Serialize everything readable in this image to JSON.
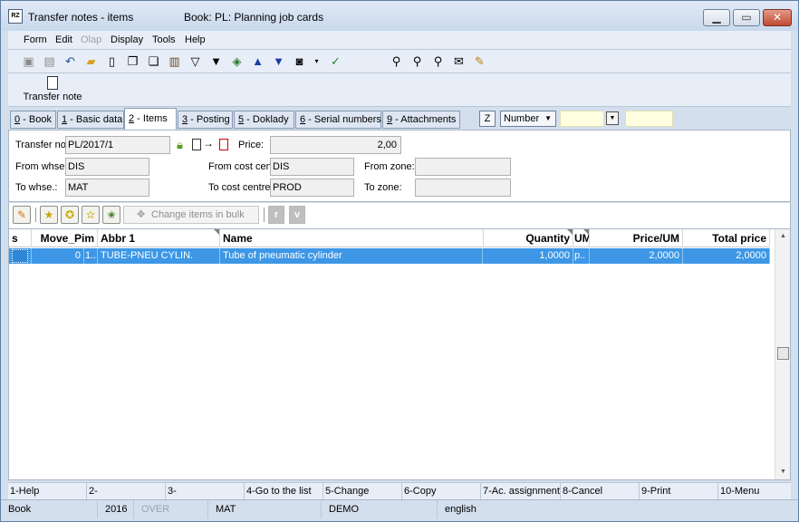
{
  "window": {
    "title": "Transfer notes - items",
    "book_title": "Book: PL: Planning job cards",
    "app_icon_text": "RZ"
  },
  "menu": {
    "items": [
      "Form",
      "Edit",
      "Olap",
      "Display",
      "Tools",
      "Help"
    ]
  },
  "quickbar": {
    "transfer_note_label": "Transfer note"
  },
  "tabs": [
    {
      "key": "0",
      "label": " - Book"
    },
    {
      "key": "1",
      "label": " - Basic data"
    },
    {
      "key": "2",
      "label": " - Items"
    },
    {
      "key": "3",
      "label": " - Posting"
    },
    {
      "key": "5",
      "label": " - Doklady"
    },
    {
      "key": "6",
      "label": " - Serial numbers"
    },
    {
      "key": "9",
      "label": " - Attachments"
    }
  ],
  "tab_controls": {
    "z_button": "Z",
    "sort_combo_value": "Number"
  },
  "form": {
    "transfer_note_label": "Transfer no",
    "transfer_note_value": "PL/2017/1",
    "price_label": "Price:",
    "price_value": "2,00",
    "from_whse_label": "From whse.:",
    "from_whse_value": "DIS",
    "from_cost_center_label": "From cost cen",
    "from_cost_center_value": "DIS",
    "from_zone_label": "From zone:",
    "from_zone_value": "",
    "to_whse_label": "To whse.:",
    "to_whse_value": "MAT",
    "to_cost_centre_label": "To cost centre",
    "to_cost_centre_value": "PROD",
    "to_zone_label": "To zone:",
    "to_zone_value": ""
  },
  "items_toolbar": {
    "change_items_in_bulk": "Change items in bulk",
    "r_button": "r",
    "v_button": "v"
  },
  "grid": {
    "columns": {
      "s": "s",
      "move_pim": "Move_Pim",
      "abbr1": "Abbr 1",
      "name": "Name",
      "quantity": "Quantity",
      "um": "UM",
      "price_um": "Price/UM",
      "total_price": "Total price"
    },
    "rows": [
      {
        "s": "",
        "move_pim": "0",
        "extra": "1...",
        "abbr1": "TUBE-PNEU CYLIN.",
        "name": "Tube of pneumatic cylinder",
        "quantity": "1,0000",
        "um": "p..",
        "price_um": "2,0000",
        "total_price": "2,0000"
      }
    ]
  },
  "fkeys": [
    "1-Help",
    "2-",
    "3-",
    "4-Go to the list",
    "5-Change",
    "6-Copy",
    "7-Ac. assignment",
    "8-Cancel",
    "9-Print",
    "10-Menu"
  ],
  "status": {
    "module": "Book",
    "year": "2016",
    "mode": "OVER",
    "warehouse": "MAT",
    "database": "DEMO",
    "language": "english"
  },
  "colors": {
    "selected_row": "#3d97e6",
    "title_gradient_top": "#e1eaf6",
    "highlight_field": "#ffffe0"
  }
}
